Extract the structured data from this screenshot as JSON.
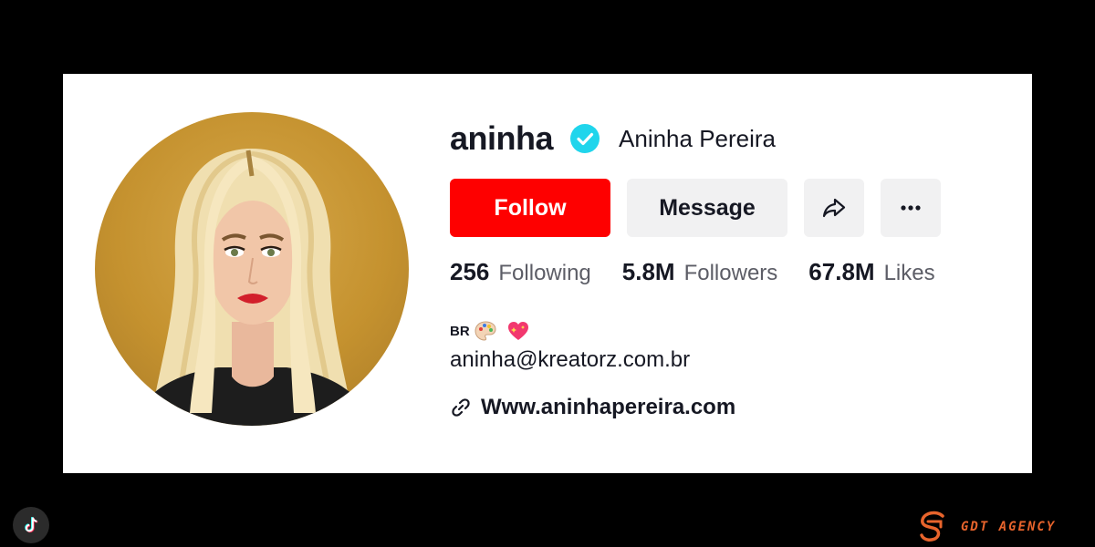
{
  "profile": {
    "username": "aninha",
    "display_name": "Aninha Pereira",
    "verified": true
  },
  "actions": {
    "follow_label": "Follow",
    "message_label": "Message",
    "share_icon": "share-icon",
    "more_icon": "more-icon"
  },
  "stats": [
    {
      "value": "256",
      "label": "Following"
    },
    {
      "value": "5.8M",
      "label": "Followers"
    },
    {
      "value": "67.8M",
      "label": "Likes"
    }
  ],
  "bio": {
    "country": "BR",
    "emojis": [
      "palette-emoji",
      "sparkling-heart-emoji"
    ],
    "email": "aninha@kreatorz.com.br",
    "link": "Www.aninhapereira.com",
    "link_icon": "link-icon"
  },
  "branding": {
    "app_logo": "tiktok-icon",
    "agency_name": "GDT AGENCY"
  },
  "colors": {
    "follow_bg": "#fe0000",
    "button_bg": "#f1f1f2",
    "verified": "#20d5ec",
    "agency_accent": "#e8642c"
  }
}
